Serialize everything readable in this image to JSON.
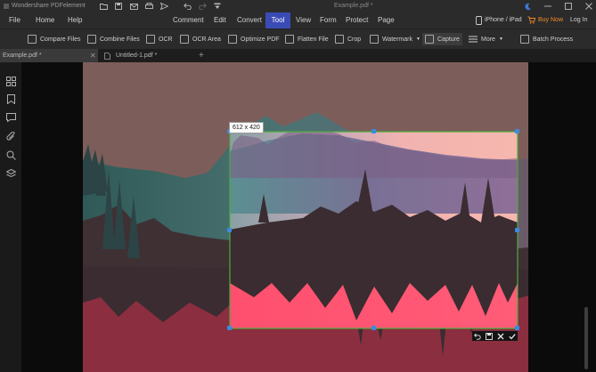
{
  "app": {
    "title": "Wondershare PDFelement",
    "document_title": "Example.pdf *"
  },
  "menubar": {
    "left": [
      "File",
      "Home",
      "Help"
    ],
    "main": [
      "Comment",
      "Edit",
      "Convert",
      "Tool",
      "View",
      "Form",
      "Protect",
      "Page"
    ],
    "active": "Tool",
    "device": "iPhone / iPad",
    "buy_now": "Buy Now",
    "login": "Log In"
  },
  "toolbar": {
    "items": [
      "Compare Files",
      "Combine Files",
      "OCR",
      "OCR Area",
      "Optimize PDF",
      "Flatten File",
      "Crop",
      "Watermark",
      "Capture",
      "More",
      "Batch Process"
    ],
    "selected": "Capture"
  },
  "tabs": [
    {
      "label": "Example.pdf *",
      "active": true
    },
    {
      "label": "Untitled-1.pdf *",
      "active": false
    }
  ],
  "capture": {
    "size_label": "612 x 420"
  },
  "colors": {
    "accent": "#3b4bb5",
    "buy_now": "#f0892d",
    "selection": "#4caf3a",
    "handle": "#3a8be0"
  },
  "icons": {
    "sidebar": [
      "thumbnails-icon",
      "bookmark-icon",
      "comment-icon",
      "attachment-icon",
      "search-icon",
      "layers-icon"
    ],
    "capture_actions": [
      "undo-icon",
      "save-icon",
      "close-icon",
      "check-icon"
    ]
  }
}
